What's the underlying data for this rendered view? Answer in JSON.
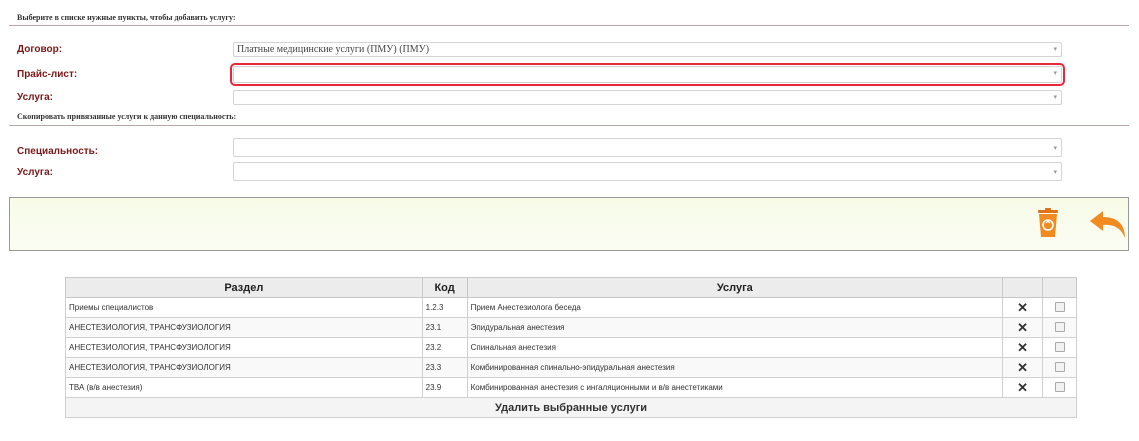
{
  "form": {
    "section1_title": "Выберите в списке нужные пункты, чтобы добавить услугу:",
    "contract_label": "Договор:",
    "contract_value": "Платные медицинские услуги (ПМУ) (ПМУ)",
    "pricelist_label": "Прайс-лист:",
    "pricelist_value": "",
    "service_label": "Услуга:",
    "service_value": "",
    "section2_title": "Скопировать привязанные услуги к данную специальность:",
    "specialty_label": "Специальность:",
    "specialty_value": "",
    "service2_label": "Услуга:",
    "service2_value": "",
    "dropdown_arrow": "▾"
  },
  "icons": {
    "trash": "trash-icon",
    "back": "back-arrow-icon",
    "delete": "delete-x-icon",
    "checkbox": "checkbox"
  },
  "colors": {
    "label": "#7a1818",
    "highlight": "#e8283a",
    "trash": "#f28a22",
    "delete": "#d21a1a",
    "link": "#2b2bb0"
  },
  "table": {
    "headers": [
      "Раздел",
      "Код",
      "Услуга",
      "",
      ""
    ],
    "rows": [
      {
        "section": "Приемы специалистов",
        "code": "1.2.3",
        "service": "Прием Анестезиолога беседа"
      },
      {
        "section": "АНЕСТЕЗИОЛОГИЯ, ТРАНСФУЗИОЛОГИЯ",
        "code": "23.1",
        "service": "Эпидуральная анестезия"
      },
      {
        "section": "АНЕСТЕЗИОЛОГИЯ, ТРАНСФУЗИОЛОГИЯ",
        "code": "23.2",
        "service": "Спинальная анестезия"
      },
      {
        "section": "АНЕСТЕЗИОЛОГИЯ, ТРАНСФУЗИОЛОГИЯ",
        "code": "23.3",
        "service": "Комбинированная спинально-эпидуральная анестезия"
      },
      {
        "section": "ТВА (в/в анестезия)",
        "code": "23.9",
        "service": "Комбинированная анестезия с ингаляционными и в/в анестетиками"
      }
    ],
    "delete_symbol": "✕",
    "footer_link": "Удалить выбранные услуги"
  }
}
